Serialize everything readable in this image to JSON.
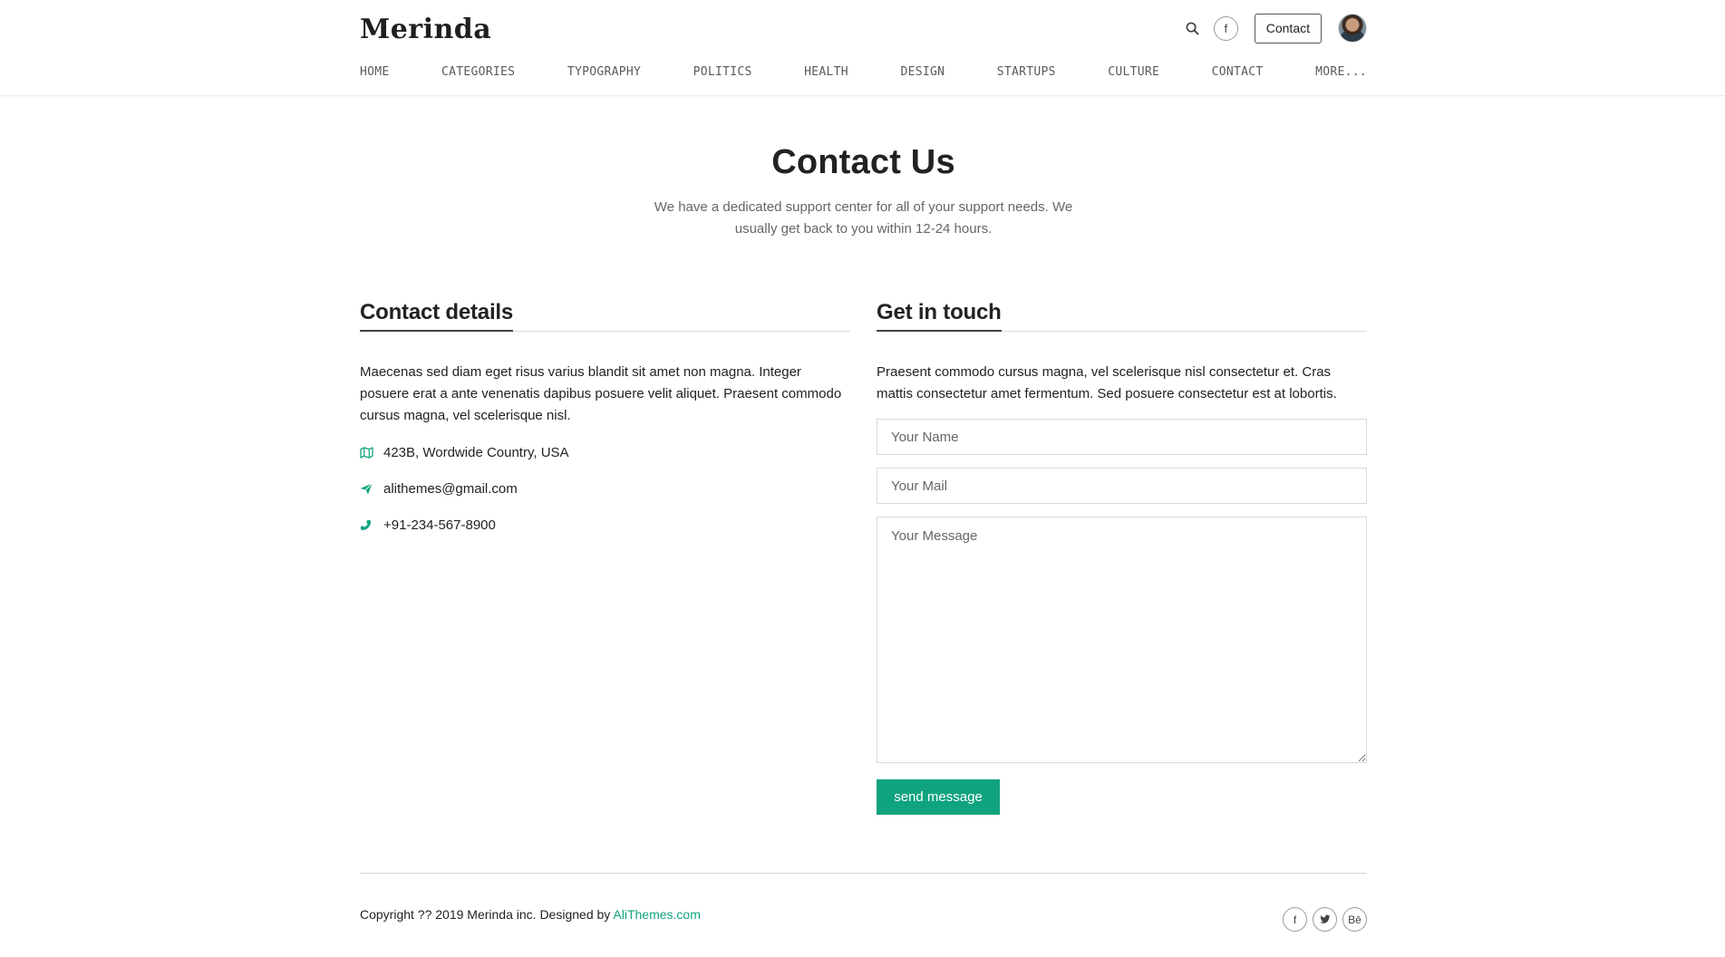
{
  "header": {
    "logo": "Merinda",
    "contact_label": "Contact",
    "social_facebook": "f",
    "nav": [
      "HOME",
      "CATEGORIES",
      "TYPOGRAPHY",
      "POLITICS",
      "HEALTH",
      "DESIGN",
      "STARTUPS",
      "CULTURE",
      "CONTACT",
      "MORE..."
    ]
  },
  "hero": {
    "title": "Contact Us",
    "subtitle": "We have a dedicated support center for all of your support needs. We usually get back to you within 12-24 hours."
  },
  "details": {
    "title": "Contact details",
    "intro": "Maecenas sed diam eget risus varius blandit sit amet non magna. Integer posuere erat a ante venenatis dapibus posuere velit aliquet. Praesent commodo cursus magna, vel scelerisque nisl.",
    "address": "423B, Wordwide Country, USA",
    "email": "alithemes@gmail.com",
    "phone": "+91-234-567-8900",
    "icons": {
      "address": "map-icon",
      "email": "send-icon",
      "phone": "phone-icon"
    }
  },
  "form": {
    "title": "Get in touch",
    "intro": "Praesent commodo cursus magna, vel scelerisque nisl consectetur et. Cras mattis consectetur amet fermentum. Sed posuere consectetur est at lobortis.",
    "name_placeholder": "Your Name",
    "mail_placeholder": "Your Mail",
    "message_placeholder": "Your Message",
    "submit_label": "send message"
  },
  "footer": {
    "copyright": "Copyright ?? 2019 Merinda inc. Designed by ",
    "link": "AliThemes.com",
    "social": [
      "f",
      "t",
      "Bē"
    ]
  },
  "colors": {
    "accent": "#10a37f",
    "text": "#222222",
    "muted": "#666666"
  }
}
